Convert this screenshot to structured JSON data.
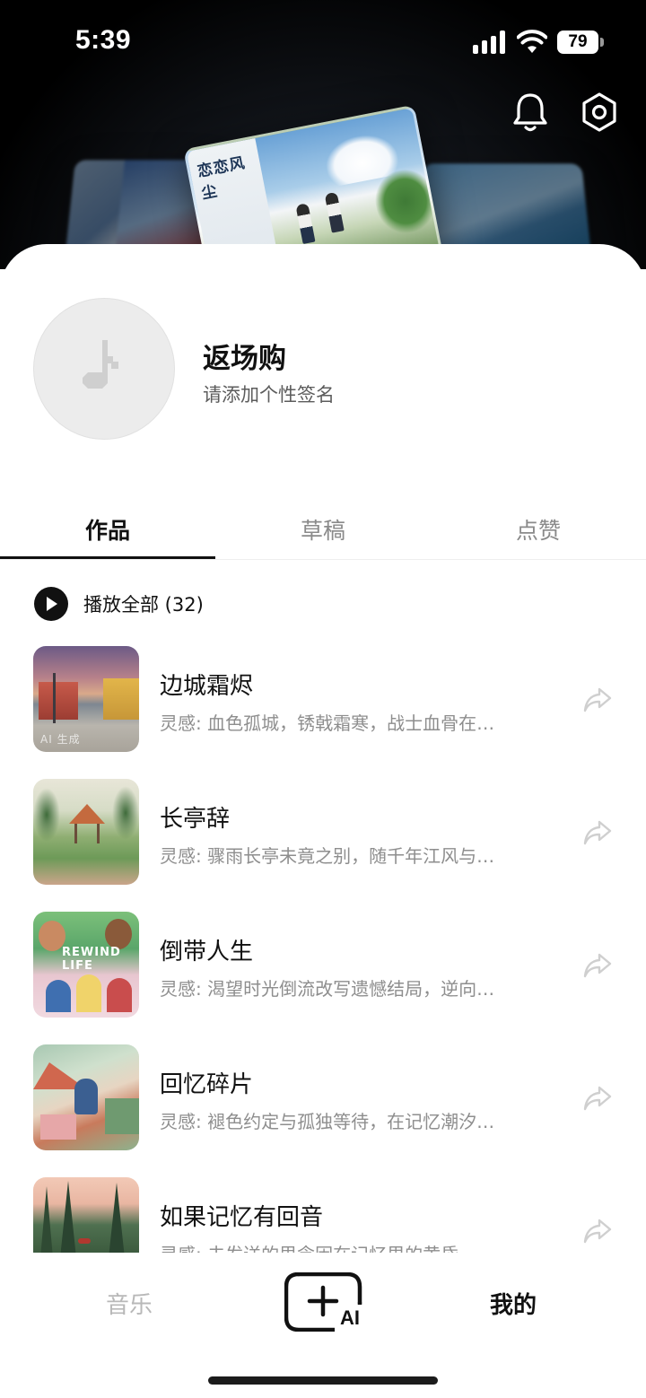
{
  "status_bar": {
    "time": "5:39",
    "battery": "79"
  },
  "header": {
    "bell_icon": "bell-icon",
    "settings_icon": "hexagon-settings-icon",
    "featured_album_title": "恋恋风尘"
  },
  "profile": {
    "username": "返场购",
    "signature_placeholder": "请添加个性签名"
  },
  "tabs": [
    {
      "label": "作品",
      "active": true
    },
    {
      "label": "草稿",
      "active": false
    },
    {
      "label": "点赞",
      "active": false
    }
  ],
  "play_all": {
    "label": "播放全部 (32)"
  },
  "songs": [
    {
      "title": "边城霜烬",
      "desc": "灵感: 血色孤城，锈戟霜寒，战士血骨在…",
      "cover_badge": "AI 生成"
    },
    {
      "title": "长亭辞",
      "desc": "灵感: 骤雨长亭未竟之别，随千年江风与…",
      "cover_badge": ""
    },
    {
      "title": "倒带人生",
      "desc": "灵感: 渴望时光倒流改写遗憾结局，逆向…",
      "cover_badge": "REWIND LIFE"
    },
    {
      "title": "回忆碎片",
      "desc": "灵感: 褪色约定与孤独等待，在记忆潮汐…",
      "cover_badge": ""
    },
    {
      "title": "如果记忆有回音",
      "desc": "灵感: 未发送的思念困在记忆里的黄昏",
      "cover_badge": ""
    }
  ],
  "bottom_nav": {
    "music_label": "音乐",
    "create_label": "AI",
    "mine_label": "我的"
  },
  "colors": {
    "text_primary": "#111111",
    "text_secondary": "#8e8e8e",
    "nav_inactive": "#b8b8b8",
    "background": "#ffffff"
  }
}
